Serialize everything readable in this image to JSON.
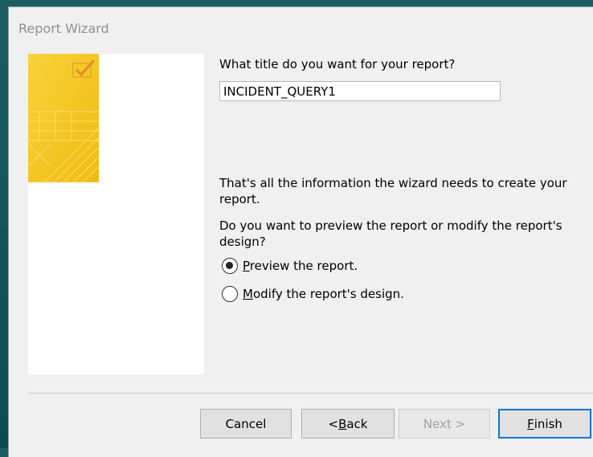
{
  "window": {
    "title": "Report Wizard"
  },
  "wizard": {
    "title_question": "What title do you want for your report?",
    "report_title_value": "INCIDENT_QUERY1",
    "info_text": "That's all the information the wizard needs to create your report.",
    "preview_question": "Do you want to preview the report or modify the report's design?",
    "options": [
      {
        "label": "Preview the report.",
        "selected": true
      },
      {
        "label": "Modify the report's design.",
        "selected": false
      }
    ]
  },
  "buttons": {
    "cancel": "Cancel",
    "back": "< Back",
    "next": "Next >",
    "finish": "Finish",
    "next_enabled": false
  },
  "colors": {
    "graphic_yellow": "#f5c518",
    "focus_border": "#0078d7",
    "dialog_bg": "#f0f0f0",
    "desktop_bg": "#1c5d62"
  }
}
